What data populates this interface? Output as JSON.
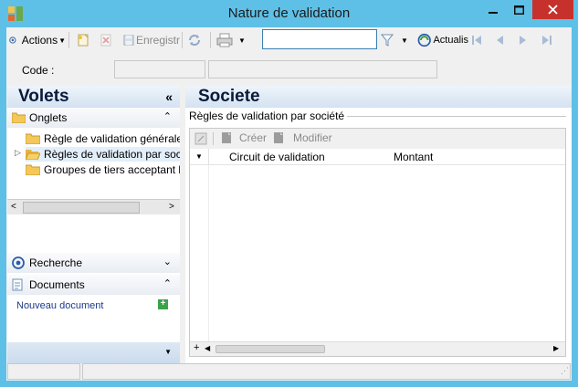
{
  "window": {
    "title": "Nature de validation",
    "accent": "#5ec0e6",
    "close_color": "#c7312c"
  },
  "toolbar": {
    "actions_label": "Actions",
    "enregistrer_label": "Enregistr",
    "search_value": "",
    "actualiser_label": "Actualis"
  },
  "code": {
    "label": "Code :",
    "value": "",
    "description": ""
  },
  "left_panel": {
    "title": "Volets",
    "onglets": {
      "label": "Onglets",
      "items": [
        {
          "label": "Règle de validation générale"
        },
        {
          "label": "Règles de validation par soc"
        },
        {
          "label": "Groupes de tiers acceptant l"
        }
      ]
    },
    "recherche": {
      "label": "Recherche"
    },
    "documents": {
      "label": "Documents",
      "new_doc_label": "Nouveau document"
    }
  },
  "right_panel": {
    "title": "Societe",
    "group_label": "Règles de validation par société",
    "grid": {
      "create_label": "Créer",
      "modify_label": "Modifier",
      "columns": [
        "Circuit de validation",
        "Montant"
      ]
    }
  },
  "icons": [
    "app-icon",
    "minimize-icon",
    "maximize-icon",
    "close-icon",
    "actions-icon",
    "new-icon",
    "delete-icon",
    "save-icon",
    "refresh-icon",
    "print-icon",
    "filter-icon",
    "actualiser-icon",
    "first-icon",
    "prev-icon",
    "next-icon",
    "last-icon",
    "folder-icon",
    "search-panel-icon",
    "documents-icon",
    "plus-icon"
  ]
}
